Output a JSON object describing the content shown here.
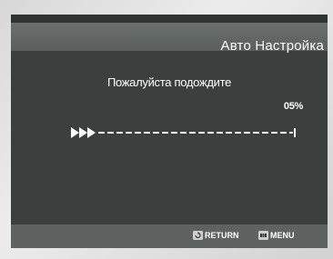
{
  "header": {
    "title": "Авто Настройка"
  },
  "dialog": {
    "message": "Пожалуйста подождите",
    "progress_text": "05%",
    "progress_fraction": 0.05
  },
  "footer": {
    "return_label": "RETURN",
    "return_icon": "return-icon",
    "menu_label": "MENU",
    "menu_icon": "menu-icon"
  }
}
